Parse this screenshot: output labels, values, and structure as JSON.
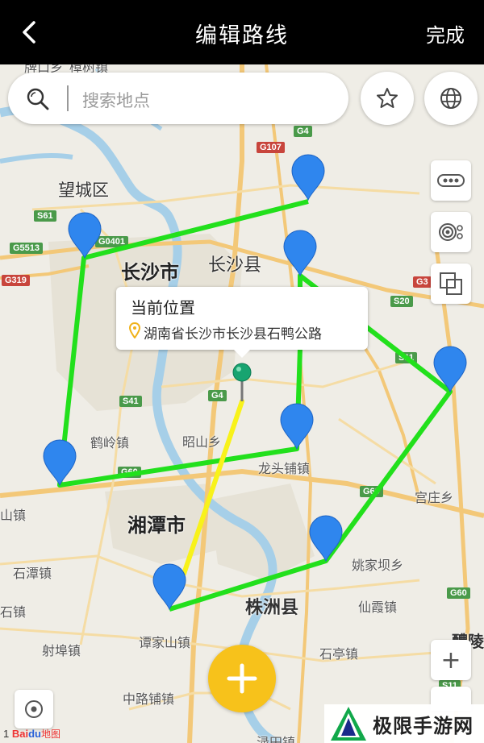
{
  "header": {
    "back_icon": "chevron-left-icon",
    "title": "编辑路线",
    "done_label": "完成"
  },
  "search": {
    "placeholder": "搜索地点",
    "icon": "search-icon"
  },
  "controls": {
    "favorite_icon": "star-icon",
    "layers_icon": "globe-icon",
    "traffic_icon": "traffic-icon",
    "panorama_icon": "panorama-icon",
    "overlay_icon": "overlay-icon",
    "locate_icon": "locate-icon",
    "zoom_in_label": "+",
    "add_icon": "plus-icon"
  },
  "callout": {
    "title": "当前位置",
    "address": "湖南省长沙市长沙县石鸭公路"
  },
  "map_labels": {
    "cities": [
      "长沙市",
      "长沙县",
      "湘潭市",
      "株洲县",
      "望城区"
    ],
    "towns": [
      "鹤岭镇",
      "昭山乡",
      "龙头铺镇",
      "姚家坝乡",
      "仙霞镇",
      "宫庄乡",
      "石潭镇",
      "谭家山镇",
      "射埠镇",
      "石亭镇",
      "中路铺镇",
      "山镇",
      "石镇",
      "醴陵",
      "渌田镇",
      "樟树镇",
      "牌口乡"
    ],
    "roads": [
      "G107",
      "G4",
      "S61",
      "G5513",
      "G0401",
      "G319",
      "S41",
      "G4",
      "G60",
      "S20",
      "G3",
      "S11",
      "G60",
      "G60",
      "S11"
    ]
  },
  "route": {
    "color_route": "#22e01c",
    "color_leg": "#f8f21a",
    "marker_color": "#2f86ee",
    "waypoint_count": 9
  },
  "attribution": {
    "baidu_b": "Bai",
    "baidu_du": "du",
    "baidu_map": "地图",
    "scale_prefix": "1"
  },
  "watermark": {
    "text": "极限手游网"
  }
}
